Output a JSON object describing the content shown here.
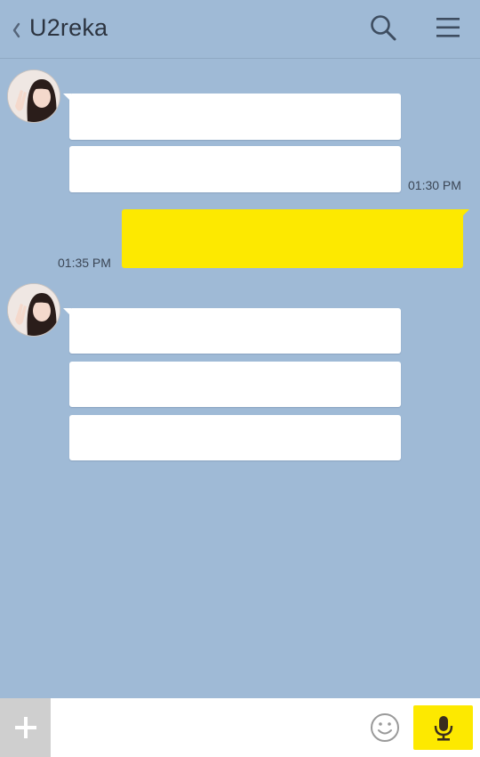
{
  "header": {
    "back_icon": "chevron-left-icon",
    "title": "U2reka",
    "search_icon": "search-icon",
    "menu_icon": "hamburger-menu-icon"
  },
  "chat": {
    "groups": [
      {
        "sender": "U2reka",
        "avatar_icon": "avatar-photo",
        "messages": [
          "",
          ""
        ],
        "time": "01:30 PM"
      },
      {
        "sender": "me",
        "messages": [
          ""
        ],
        "time": "01:35 PM"
      },
      {
        "sender": "U2reka",
        "avatar_icon": "avatar-photo",
        "messages": [
          "",
          "",
          ""
        ],
        "time": ""
      }
    ]
  },
  "input_bar": {
    "attach_icon": "plus-icon",
    "input_value": "",
    "input_placeholder": "",
    "emoji_icon": "smiley-icon",
    "mic_icon": "microphone-icon"
  },
  "colors": {
    "background": "#9fbad6",
    "my_bubble": "#fde900",
    "their_bubble": "#ffffff",
    "mic_button": "#fde900",
    "attach_button": "#cfcfcf"
  }
}
